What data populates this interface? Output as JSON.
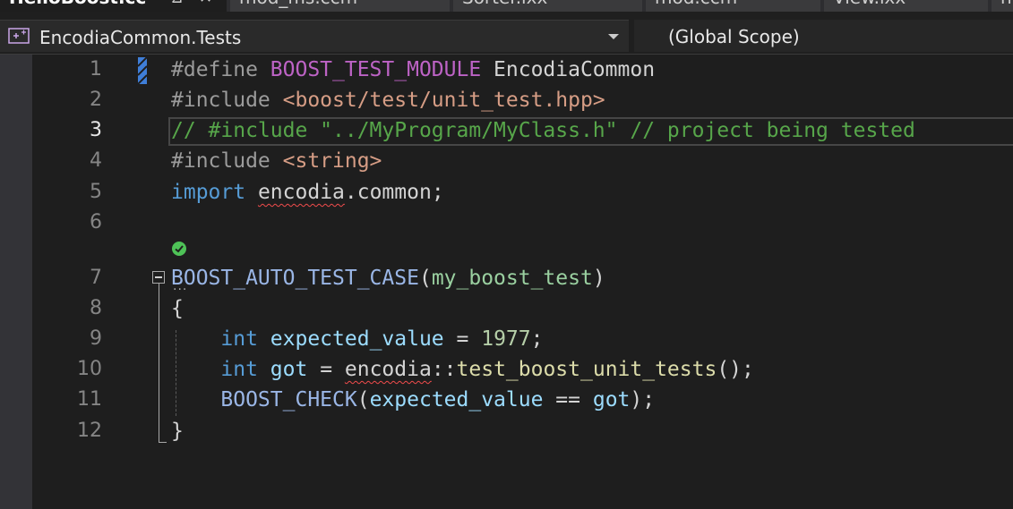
{
  "tabs": [
    {
      "label": "HelloBoost.cc",
      "active": true
    },
    {
      "label": "mod_ms.ccm",
      "active": false
    },
    {
      "label": "Sorter.ixx",
      "active": false
    },
    {
      "label": "mod.ccm",
      "active": false
    },
    {
      "label": "View.ixx",
      "active": false
    },
    {
      "label": "n",
      "active": false
    }
  ],
  "nav": {
    "project": "EncodiaCommon.Tests",
    "scope": "(Global Scope)"
  },
  "editor": {
    "current_line": "3",
    "line_numbers": [
      "1",
      "2",
      "3",
      "4",
      "5",
      "6",
      "7",
      "8",
      "9",
      "10",
      "11",
      "12"
    ],
    "lines": [
      [
        {
          "t": "#define ",
          "c": "pp"
        },
        {
          "t": "BOOST_TEST_MODULE",
          "c": "macro"
        },
        {
          "t": " EncodiaCommon",
          "c": "plain"
        }
      ],
      [
        {
          "t": "#include ",
          "c": "pp"
        },
        {
          "t": "<boost/test/unit_test.hpp>",
          "c": "inc"
        }
      ],
      [
        {
          "t": "// #include \"../MyProgram/MyClass.h\" // project being tested",
          "c": "cmt"
        }
      ],
      [
        {
          "t": "#include ",
          "c": "pp"
        },
        {
          "t": "<string>",
          "c": "inc"
        }
      ],
      [
        {
          "t": "import",
          "c": "kw"
        },
        {
          "t": " ",
          "c": "plain"
        },
        {
          "t": "encodia",
          "c": "plain squiggle"
        },
        {
          "t": ".common;",
          "c": "plain"
        }
      ],
      [],
      [
        {
          "t": "BOOST_AUTO_TEST_CASE",
          "c": "macrocall"
        },
        {
          "t": "(",
          "c": "plain"
        },
        {
          "t": "my_boost_test",
          "c": "param"
        },
        {
          "t": ")",
          "c": "plain"
        }
      ],
      [
        {
          "t": "{",
          "c": "plain"
        }
      ],
      [
        {
          "t": "    ",
          "c": "plain"
        },
        {
          "t": "int",
          "c": "kw"
        },
        {
          "t": " ",
          "c": "plain"
        },
        {
          "t": "expected_value",
          "c": "var"
        },
        {
          "t": " = ",
          "c": "plain"
        },
        {
          "t": "1977",
          "c": "num"
        },
        {
          "t": ";",
          "c": "plain"
        }
      ],
      [
        {
          "t": "    ",
          "c": "plain"
        },
        {
          "t": "int",
          "c": "kw"
        },
        {
          "t": " ",
          "c": "plain"
        },
        {
          "t": "got",
          "c": "var"
        },
        {
          "t": " = ",
          "c": "plain"
        },
        {
          "t": "encodia",
          "c": "plain squiggle"
        },
        {
          "t": "::",
          "c": "plain"
        },
        {
          "t": "test_boost_unit_tests",
          "c": "fn"
        },
        {
          "t": "();",
          "c": "plain"
        }
      ],
      [
        {
          "t": "    ",
          "c": "plain"
        },
        {
          "t": "BOOST_CHECK",
          "c": "macrocall"
        },
        {
          "t": "(",
          "c": "plain"
        },
        {
          "t": "expected_value",
          "c": "var"
        },
        {
          "t": " == ",
          "c": "plain"
        },
        {
          "t": "got",
          "c": "var"
        },
        {
          "t": ");",
          "c": "plain"
        }
      ],
      [
        {
          "t": "}",
          "c": "plain"
        }
      ]
    ]
  },
  "colors": {
    "editor_bg": "#1e1e1e",
    "keyword": "#569cd6",
    "comment": "#57a64a",
    "string_include": "#d69d85",
    "macro": "#bd63c5",
    "error_squiggle": "#f14c4c",
    "test_passed": "#4ec257",
    "change_marker": "#3f7ed8"
  },
  "icons": {
    "project": "project-test-icon",
    "test_status": "test-passed-icon",
    "fold": "collapse-toggle-icon",
    "dropdown": "chevron-down-icon"
  }
}
